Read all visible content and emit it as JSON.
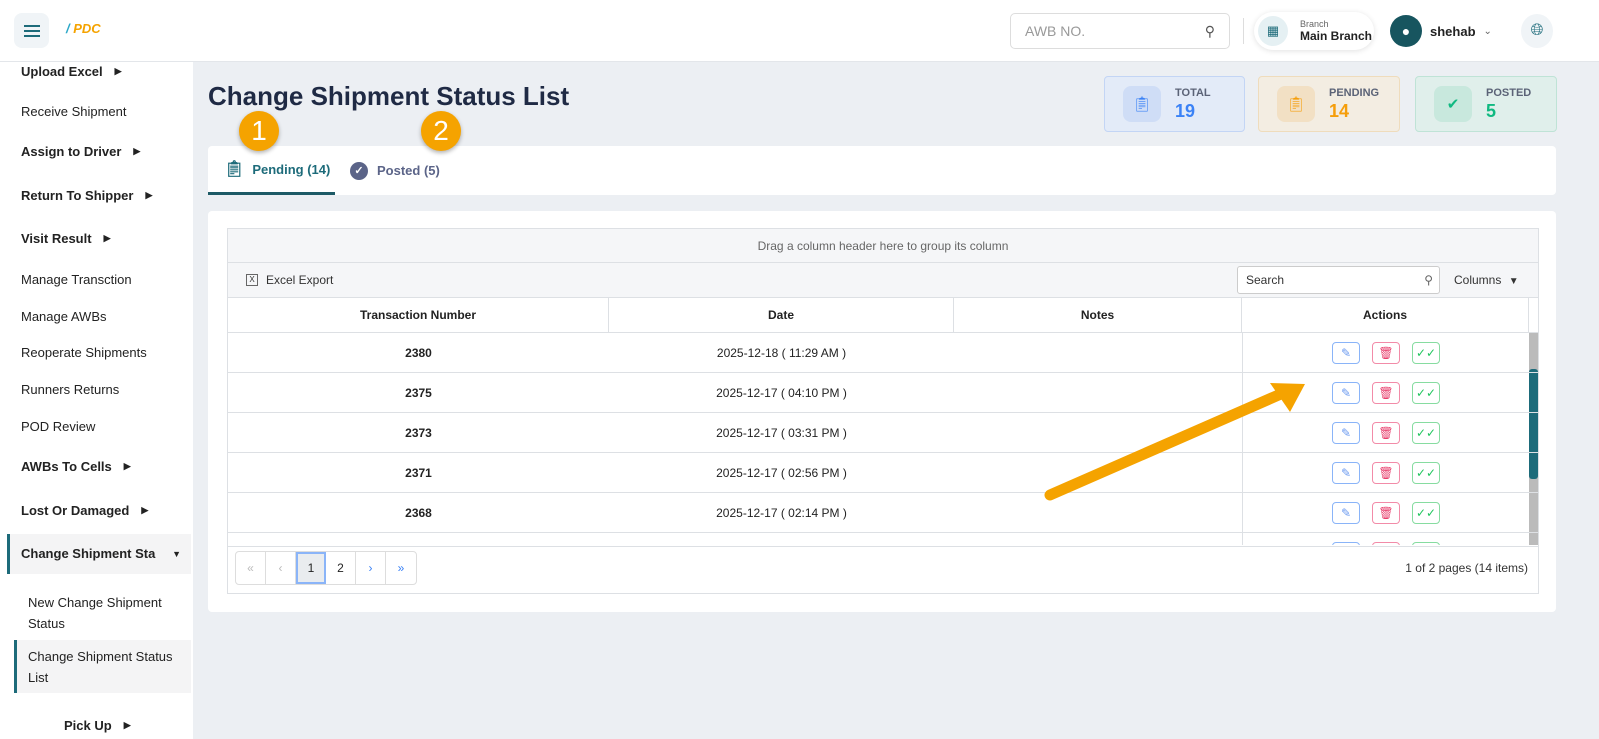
{
  "header": {
    "logo": "PDC",
    "awb_placeholder": "AWB NO.",
    "branch_label": "Branch",
    "branch_value": "Main Branch",
    "user": "shehab"
  },
  "sidebar": {
    "items": [
      {
        "label": "Upload Excel",
        "bold": true,
        "caret": true
      },
      {
        "label": "Receive Shipment"
      },
      {
        "label": "Assign to Driver",
        "bold": true,
        "caret": true
      },
      {
        "label": "Return To Shipper",
        "bold": true,
        "caret": true
      },
      {
        "label": "Visit Result",
        "bold": true,
        "caret": true
      },
      {
        "label": "Manage Transction"
      },
      {
        "label": "Manage AWBs"
      },
      {
        "label": "Reoperate Shipments"
      },
      {
        "label": "Runners Returns"
      },
      {
        "label": "POD Review"
      },
      {
        "label": "AWBs To Cells",
        "bold": true,
        "caret": true
      },
      {
        "label": "Lost Or Damaged",
        "bold": true,
        "caret": true
      },
      {
        "label": "Change Shipment Sta",
        "bold": true,
        "expanded": true
      },
      {
        "label": "New Change Shipment Status"
      },
      {
        "label": "Change Shipment Status List",
        "active": true
      },
      {
        "label": "Pick Up",
        "bold": true,
        "caret": true
      }
    ]
  },
  "page": {
    "title": "Change Shipment Status List"
  },
  "stats": [
    {
      "label": "TOTAL",
      "value": "19",
      "color": "#3b82f6"
    },
    {
      "label": "PENDING",
      "value": "14",
      "color": "#f59e0b"
    },
    {
      "label": "POSTED",
      "value": "5",
      "color": "#10b981"
    }
  ],
  "tabs": [
    {
      "label": "Pending (14)",
      "active": true
    },
    {
      "label": "Posted (5)"
    }
  ],
  "grid": {
    "group_hint": "Drag a column header here to group its column",
    "excel_export": "Excel Export",
    "search_placeholder": "Search",
    "columns_label": "Columns",
    "headers": [
      "Transaction Number",
      "Date",
      "Notes",
      "Actions"
    ],
    "rows": [
      {
        "id": "2380",
        "date": "2025-12-18 ( 11:29 AM )",
        "notes": ""
      },
      {
        "id": "2375",
        "date": "2025-12-17 ( 04:10 PM )",
        "notes": ""
      },
      {
        "id": "2373",
        "date": "2025-12-17 ( 03:31 PM )",
        "notes": ""
      },
      {
        "id": "2371",
        "date": "2025-12-17 ( 02:56 PM )",
        "notes": ""
      },
      {
        "id": "2368",
        "date": "2025-12-17 ( 02:14 PM )",
        "notes": ""
      },
      {
        "id": "",
        "date": "",
        "notes": ""
      }
    ],
    "pager": {
      "pages": [
        "1",
        "2"
      ],
      "current": "1",
      "info": "1 of 2 pages (14 items)"
    }
  },
  "annotations": [
    "1",
    "2"
  ]
}
